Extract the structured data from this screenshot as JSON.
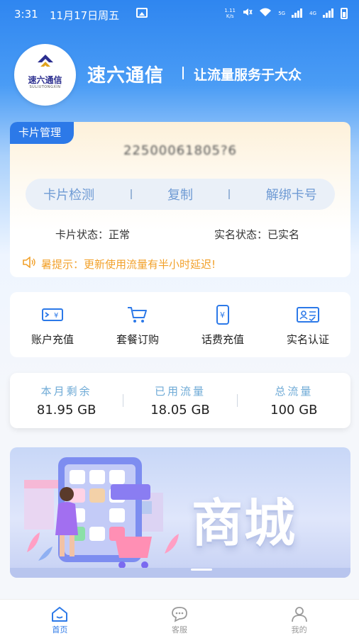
{
  "status_bar": {
    "time": "3:31",
    "date": "11月17日周五",
    "net_speed": "1.11 K/s",
    "net1": "5G",
    "net2": "4G"
  },
  "header": {
    "logo_text": "速六通信",
    "logo_subtext": "SULIUTONGXIN",
    "brand_name": "速六通信",
    "slogan": "让流量服务于大众"
  },
  "card": {
    "tag": "卡片管理",
    "number": "22500061805?6",
    "actions": [
      "卡片检测",
      "复制",
      "解绑卡号"
    ],
    "card_status": "卡片状态：正常",
    "realname_status": "实名状态：已实名",
    "notice": "暑提示：更新使用流量有半小时延迟!"
  },
  "quick_actions": [
    {
      "label": "账户充值",
      "icon": "account-recharge-icon"
    },
    {
      "label": "套餐订购",
      "icon": "cart-icon"
    },
    {
      "label": "话费充值",
      "icon": "phone-yen-icon"
    },
    {
      "label": "实名认证",
      "icon": "id-card-icon"
    }
  ],
  "traffic": [
    {
      "label": "本月剩余",
      "value": "81.95 GB"
    },
    {
      "label": "已用流量",
      "value": "18.05 GB"
    },
    {
      "label": "总流量",
      "value": "100 GB"
    }
  ],
  "banner": {
    "text": "商城"
  },
  "bottom_nav": [
    {
      "label": "首页",
      "icon": "home-icon",
      "active": true
    },
    {
      "label": "客服",
      "icon": "chat-icon",
      "active": false
    },
    {
      "label": "我的",
      "icon": "user-icon",
      "active": false
    }
  ],
  "colors": {
    "primary": "#2c79e8",
    "warning": "#f2a12b",
    "accent_light": "#6eaad6"
  }
}
